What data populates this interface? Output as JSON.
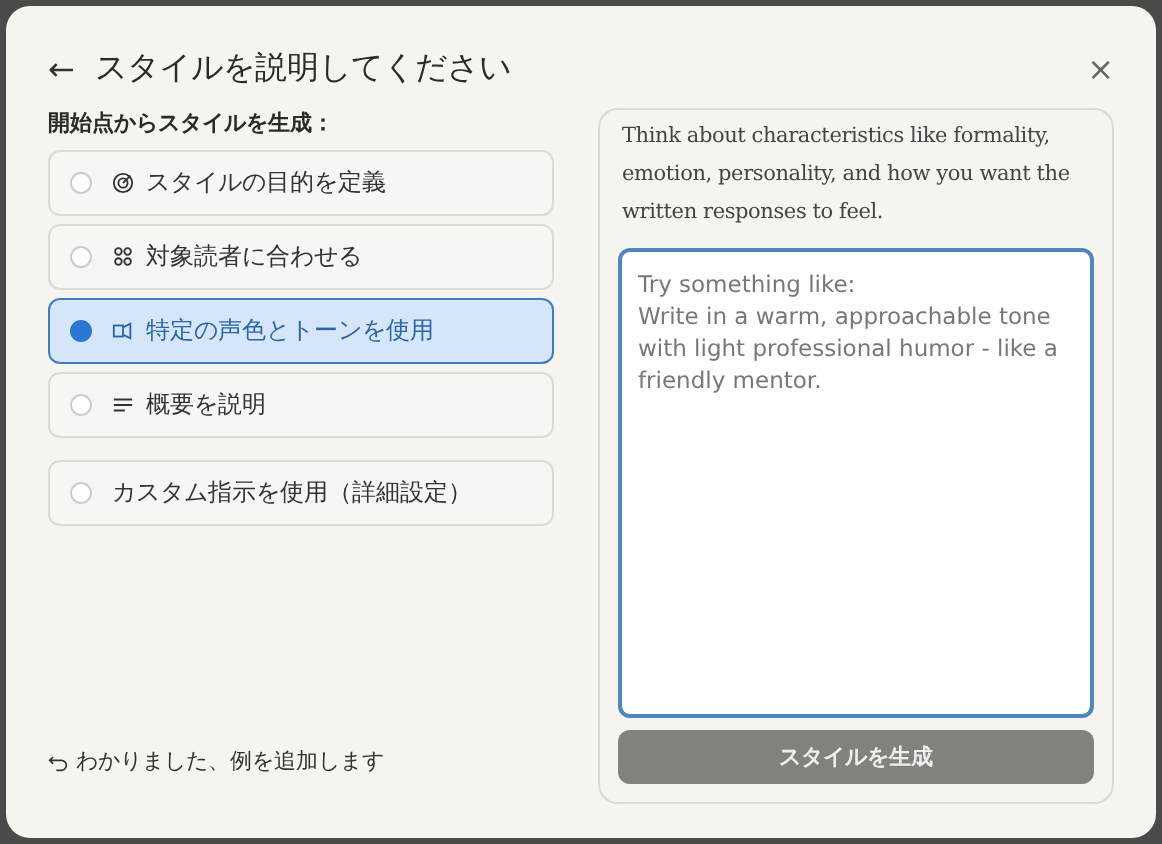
{
  "dialog": {
    "back": "←",
    "title": "スタイルを説明してください",
    "close": "×"
  },
  "section_label": "開始点からスタイルを生成：",
  "options": [
    {
      "label": "スタイルの目的を定義",
      "selected": false
    },
    {
      "label": "対象読者に合わせる",
      "selected": false
    },
    {
      "label": "特定の声色とトーンを使用",
      "selected": true
    },
    {
      "label": "概要を説明",
      "selected": false
    },
    {
      "label": "カスタム指示を使用（詳細設定）",
      "selected": false
    }
  ],
  "footer_link": "わかりました、例を追加します",
  "panel": {
    "hint": "Think about characteristics like formality, emotion, personality, and how you want the written responses to feel.",
    "placeholder": "Try something like:\nWrite in a warm, approachable tone with light professional humor - like a friendly mentor.",
    "button": "スタイルを生成"
  }
}
